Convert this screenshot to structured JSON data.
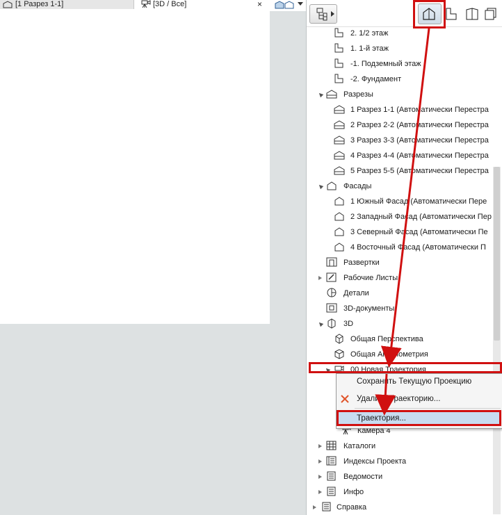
{
  "tabs": [
    {
      "label": "[1 Разрез 1-1]"
    },
    {
      "label": "[3D / Все]"
    }
  ],
  "tab_close": "×",
  "navigator": {
    "tree": [
      {
        "label": "2. 1/2 этаж",
        "icon": "story-icon",
        "indent": 2
      },
      {
        "label": "1. 1-й этаж",
        "icon": "story-icon",
        "indent": 2
      },
      {
        "label": "-1. Подземный этаж",
        "icon": "story-icon",
        "indent": 2
      },
      {
        "label": "-2. Фундамент",
        "icon": "story-icon",
        "indent": 2
      },
      {
        "label": "Разрезы",
        "icon": "section-icon",
        "indent": 1,
        "expander": "open"
      },
      {
        "label": "1 Разрез 1-1 (Автоматически Перестра",
        "icon": "section-icon",
        "indent": 2
      },
      {
        "label": "2 Разрез 2-2 (Автоматически Перестра",
        "icon": "section-icon",
        "indent": 2
      },
      {
        "label": "3 Разрез 3-3 (Автоматически Перестра",
        "icon": "section-icon",
        "indent": 2
      },
      {
        "label": "4 Разрез 4-4 (Автоматически Перестра",
        "icon": "section-icon",
        "indent": 2
      },
      {
        "label": "5 Разрез 5-5 (Автоматически Перестра",
        "icon": "section-icon",
        "indent": 2
      },
      {
        "label": "Фасады",
        "icon": "elevation-icon",
        "indent": 1,
        "expander": "open"
      },
      {
        "label": "1 Южный Фасад (Автоматически Пере",
        "icon": "elevation-icon",
        "indent": 2
      },
      {
        "label": "2 Западный Фасад (Автоматически Пер",
        "icon": "elevation-icon",
        "indent": 2
      },
      {
        "label": "3 Северный Фасад (Автоматически Пе",
        "icon": "elevation-icon",
        "indent": 2
      },
      {
        "label": "4 Восточный Фасад (Автоматически П",
        "icon": "elevation-icon",
        "indent": 2
      },
      {
        "label": "Развертки",
        "icon": "interior-elevation-icon",
        "indent": 1
      },
      {
        "label": "Рабочие Листы",
        "icon": "worksheet-icon",
        "indent": 1,
        "expander": "closed"
      },
      {
        "label": "Детали",
        "icon": "detail-icon",
        "indent": 1
      },
      {
        "label": "3D-документы",
        "icon": "3d-document-icon",
        "indent": 1
      },
      {
        "label": "3D",
        "icon": "3d-cube-icon",
        "indent": 1,
        "expander": "open"
      },
      {
        "label": "Общая Перспектива",
        "icon": "perspective-icon",
        "indent": 2
      },
      {
        "label": "Общая Аксонометрия",
        "icon": "axonometry-icon",
        "indent": 2
      },
      {
        "label": "00 Новая Траектория",
        "icon": "camera-path-icon",
        "indent": 2,
        "expander": "open"
      },
      {
        "label": "",
        "icon": "",
        "indent": 3
      },
      {
        "label": "",
        "icon": "",
        "indent": 3
      },
      {
        "label": "",
        "icon": "",
        "indent": 3
      },
      {
        "label": "Камера 4",
        "icon": "camera-icon",
        "indent": 3
      },
      {
        "label": "Каталоги",
        "icon": "schedule-icon",
        "indent": 1,
        "expander": "closed"
      },
      {
        "label": "Индексы Проекта",
        "icon": "index-icon",
        "indent": 1,
        "expander": "closed"
      },
      {
        "label": "Ведомости",
        "icon": "list-icon",
        "indent": 1,
        "expander": "closed"
      },
      {
        "label": "Инфо",
        "icon": "info-icon",
        "indent": 1,
        "expander": "closed"
      },
      {
        "label": "Справка",
        "icon": "help-icon",
        "indent": 0,
        "expander": "closed"
      }
    ]
  },
  "context_menu": {
    "items": [
      {
        "label": "Сохранить Текущую Проекцию"
      },
      {
        "label": "Удалить Траекторию..."
      },
      {
        "label": "Траектория..."
      }
    ]
  },
  "colors": {
    "annotation_red": "#d01010",
    "highlight": "#c8dcf0"
  }
}
